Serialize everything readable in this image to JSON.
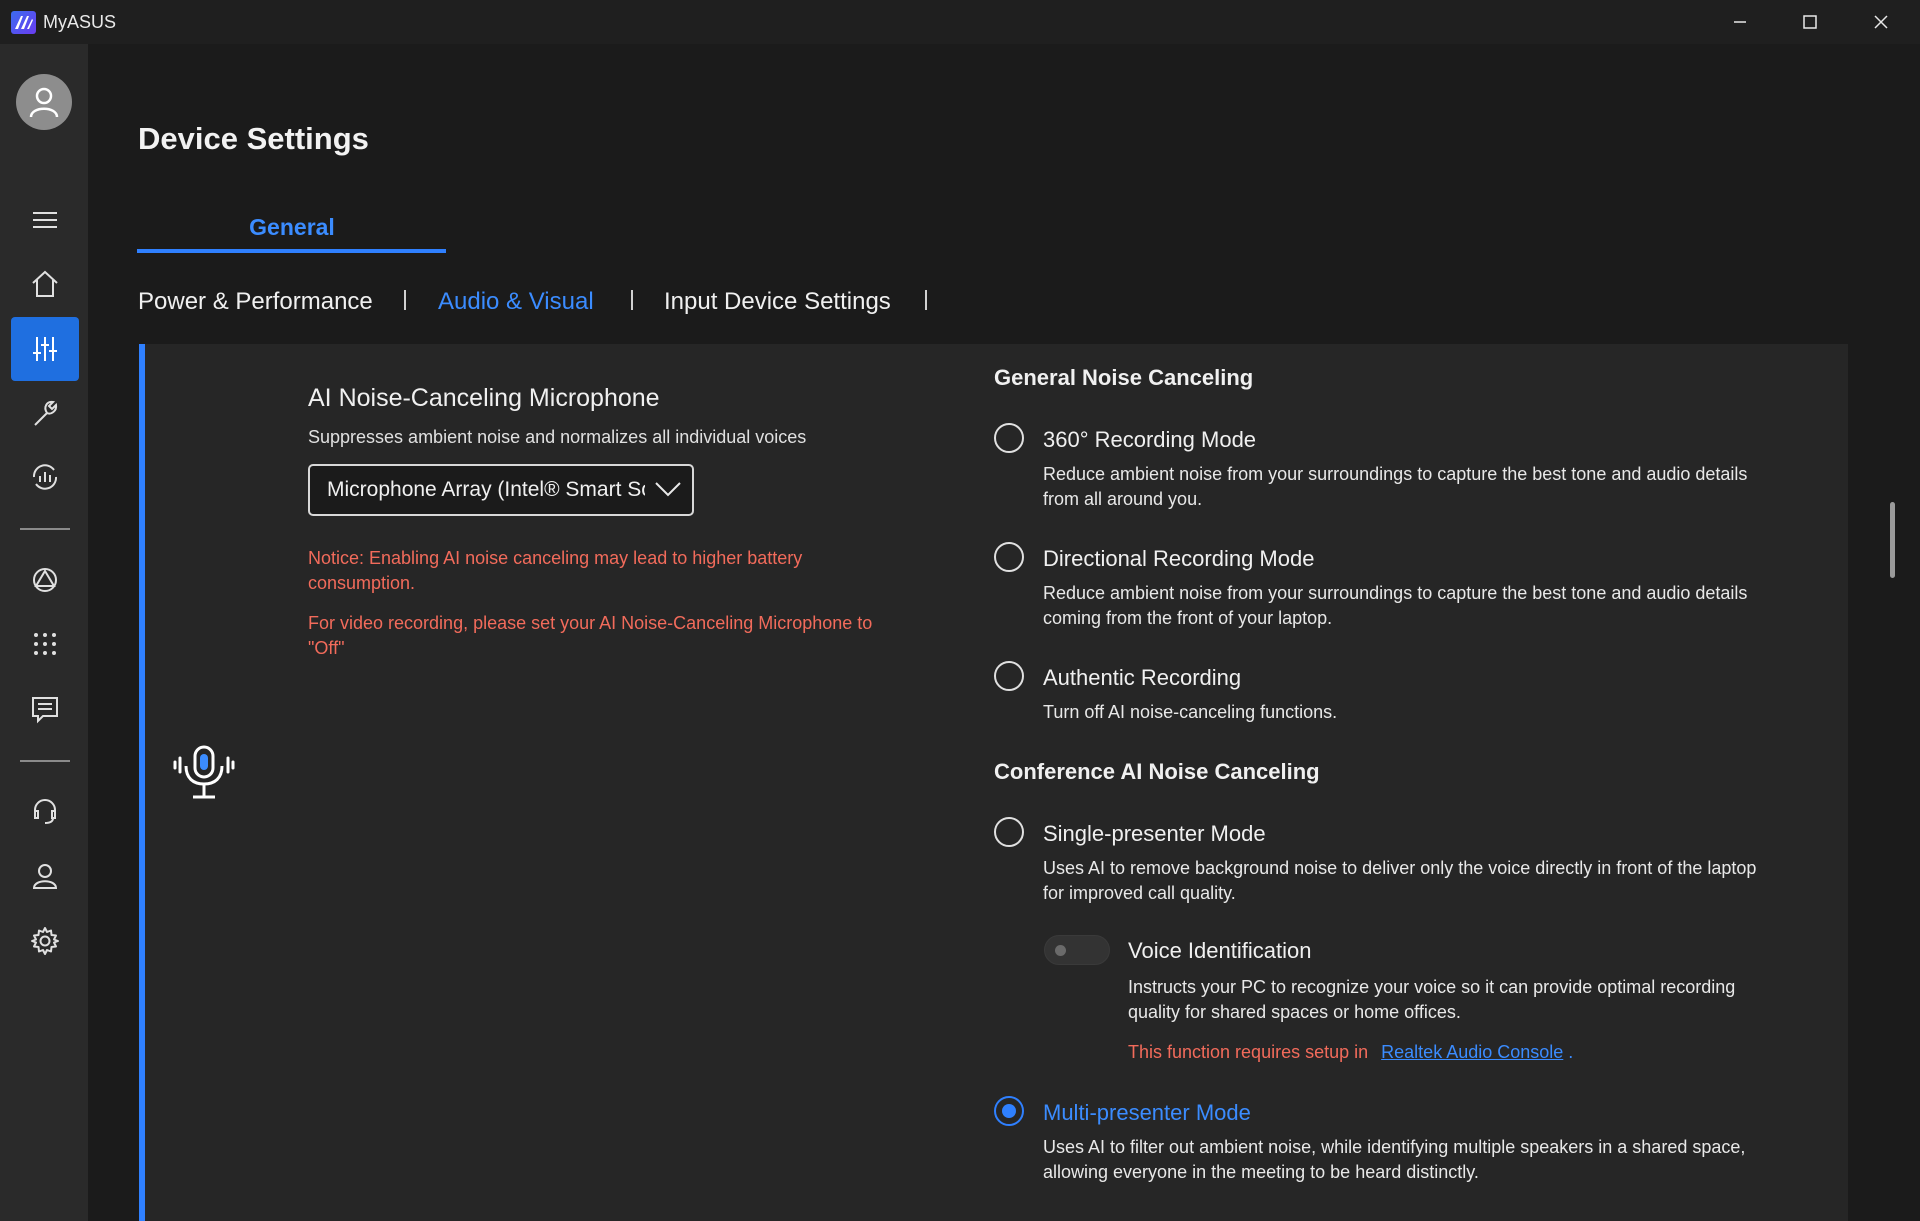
{
  "window": {
    "title": "MyASUS"
  },
  "sidebar": {
    "items": [
      {
        "icon": "avatar-icon"
      },
      {
        "icon": "menu-icon"
      },
      {
        "icon": "home-icon"
      },
      {
        "icon": "sliders-icon",
        "active": true
      },
      {
        "icon": "wrench-icon"
      },
      {
        "icon": "diagnosis-icon"
      },
      {
        "icon": "link-icon"
      },
      {
        "icon": "apps-grid-icon"
      },
      {
        "icon": "news-icon"
      },
      {
        "icon": "support-icon"
      },
      {
        "icon": "user-icon"
      },
      {
        "icon": "settings-icon"
      }
    ]
  },
  "page": {
    "title": "Device Settings"
  },
  "tabs": {
    "general": "General"
  },
  "subtabs": [
    "Power & Performance",
    "Audio & Visual",
    "Input Device Settings"
  ],
  "feature": {
    "title": "AI Noise-Canceling Microphone",
    "description": "Suppresses ambient noise and normalizes all individual voices",
    "dropdown_value": "Microphone Array (Intel® Smart Sound Technology for Digital Microphones)",
    "notice1": "Notice: Enabling AI noise canceling may lead to higher battery consumption.",
    "notice2": "For video recording, please set your AI Noise-Canceling Microphone to \"Off\""
  },
  "general_nc": {
    "heading": "General Noise Canceling",
    "options": [
      {
        "label": "360° Recording Mode",
        "desc": "Reduce ambient noise from your surroundings to capture the best tone and audio details from all around you.",
        "selected": false
      },
      {
        "label": "Directional Recording Mode",
        "desc": "Reduce ambient noise from your surroundings to capture the best tone and audio details coming from the front of your laptop.",
        "selected": false
      },
      {
        "label": "Authentic Recording",
        "desc": "Turn off AI noise-canceling functions.",
        "selected": false
      }
    ]
  },
  "conference_nc": {
    "heading": "Conference AI Noise Canceling",
    "single": {
      "label": "Single-presenter Mode",
      "desc": "Uses AI to remove background noise to deliver only the voice directly in front of the laptop for improved call quality.",
      "selected": false
    },
    "voice_id": {
      "label": "Voice Identification",
      "desc": "Instructs your PC to recognize your voice so it can provide optimal recording quality for shared spaces or home offices.",
      "req_text": "This function requires setup in",
      "req_link": "Realtek Audio Console",
      "req_end": ".",
      "enabled": false
    },
    "multi": {
      "label": "Multi-presenter Mode",
      "desc": "Uses AI to filter out ambient noise, while identifying multiple speakers in a shared space, allowing everyone in the meeting to be heard distinctly.",
      "selected": true
    }
  },
  "colors": {
    "accent": "#2f80ff",
    "notice": "#f26b5b",
    "sidebar_bg": "#2a2a2a",
    "bg": "#1b1b1b"
  }
}
